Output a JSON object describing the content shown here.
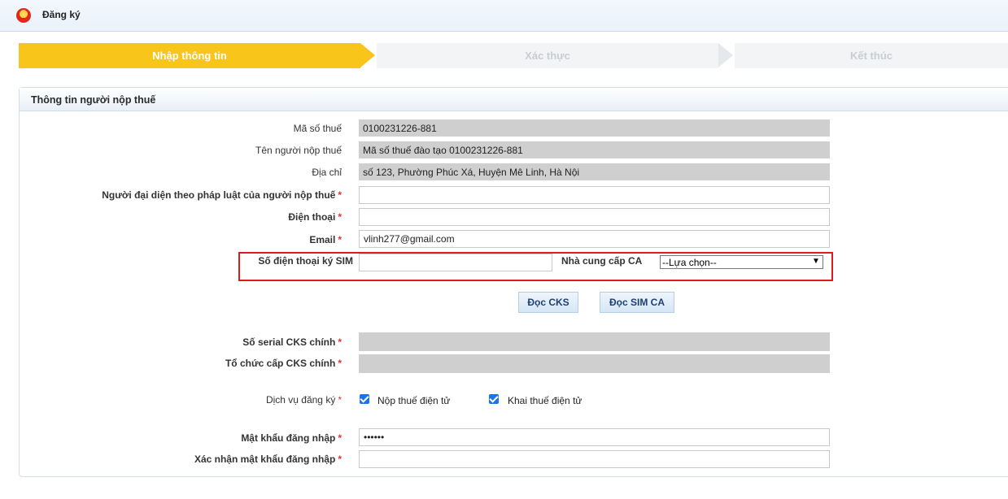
{
  "header": {
    "title": "Đăng ký"
  },
  "steps": [
    {
      "label": "Nhập thông tin",
      "active": true
    },
    {
      "label": "Xác thực",
      "active": false
    },
    {
      "label": "Kết thúc",
      "active": false
    }
  ],
  "panel": {
    "title": "Thông tin người nộp thuế"
  },
  "fields": {
    "tax_code": {
      "label": "Mã số thuế",
      "value": "0100231226-881"
    },
    "taxpayer_name": {
      "label": "Tên người nộp thuế",
      "value": "Mã số thuế đào tạo 0100231226-881"
    },
    "address": {
      "label": "Địa chỉ",
      "value": "số 123, Phường Phúc Xá, Huyện Mê Linh, Hà Nội"
    },
    "legal_rep": {
      "label": "Người đại diện theo pháp luật của người nộp thuế",
      "value": ""
    },
    "phone": {
      "label": "Điện thoại",
      "value": ""
    },
    "email": {
      "label": "Email",
      "value": "vlinh277@gmail.com"
    },
    "sim_phone": {
      "label": "Số điện thoại ký SIM",
      "value": ""
    },
    "ca_provider": {
      "label": "Nhà cung cấp CA",
      "selected": "--Lựa chọn--"
    },
    "cks_serial": {
      "label": "Số serial CKS chính",
      "value": ""
    },
    "cks_issuer": {
      "label": "Tổ chức cấp CKS chính",
      "value": ""
    },
    "services": {
      "label": "Dịch vụ đăng ký",
      "options": [
        {
          "label": "Nộp thuế điện tử",
          "checked": true
        },
        {
          "label": "Khai thuế điện tử",
          "checked": true
        }
      ]
    },
    "password": {
      "label": "Mật khẩu đăng nhập",
      "value": "••••••"
    },
    "password_confirm": {
      "label": "Xác nhận mật khẩu đăng nhập",
      "value": ""
    }
  },
  "buttons": {
    "read_cks": "Đọc CKS",
    "read_sim_ca": "Đọc SIM CA"
  },
  "colors": {
    "step_active": "#f8c51a",
    "required": "#e53232",
    "highlight_box": "#e01a1a",
    "checkbox": "#1a73e8"
  }
}
